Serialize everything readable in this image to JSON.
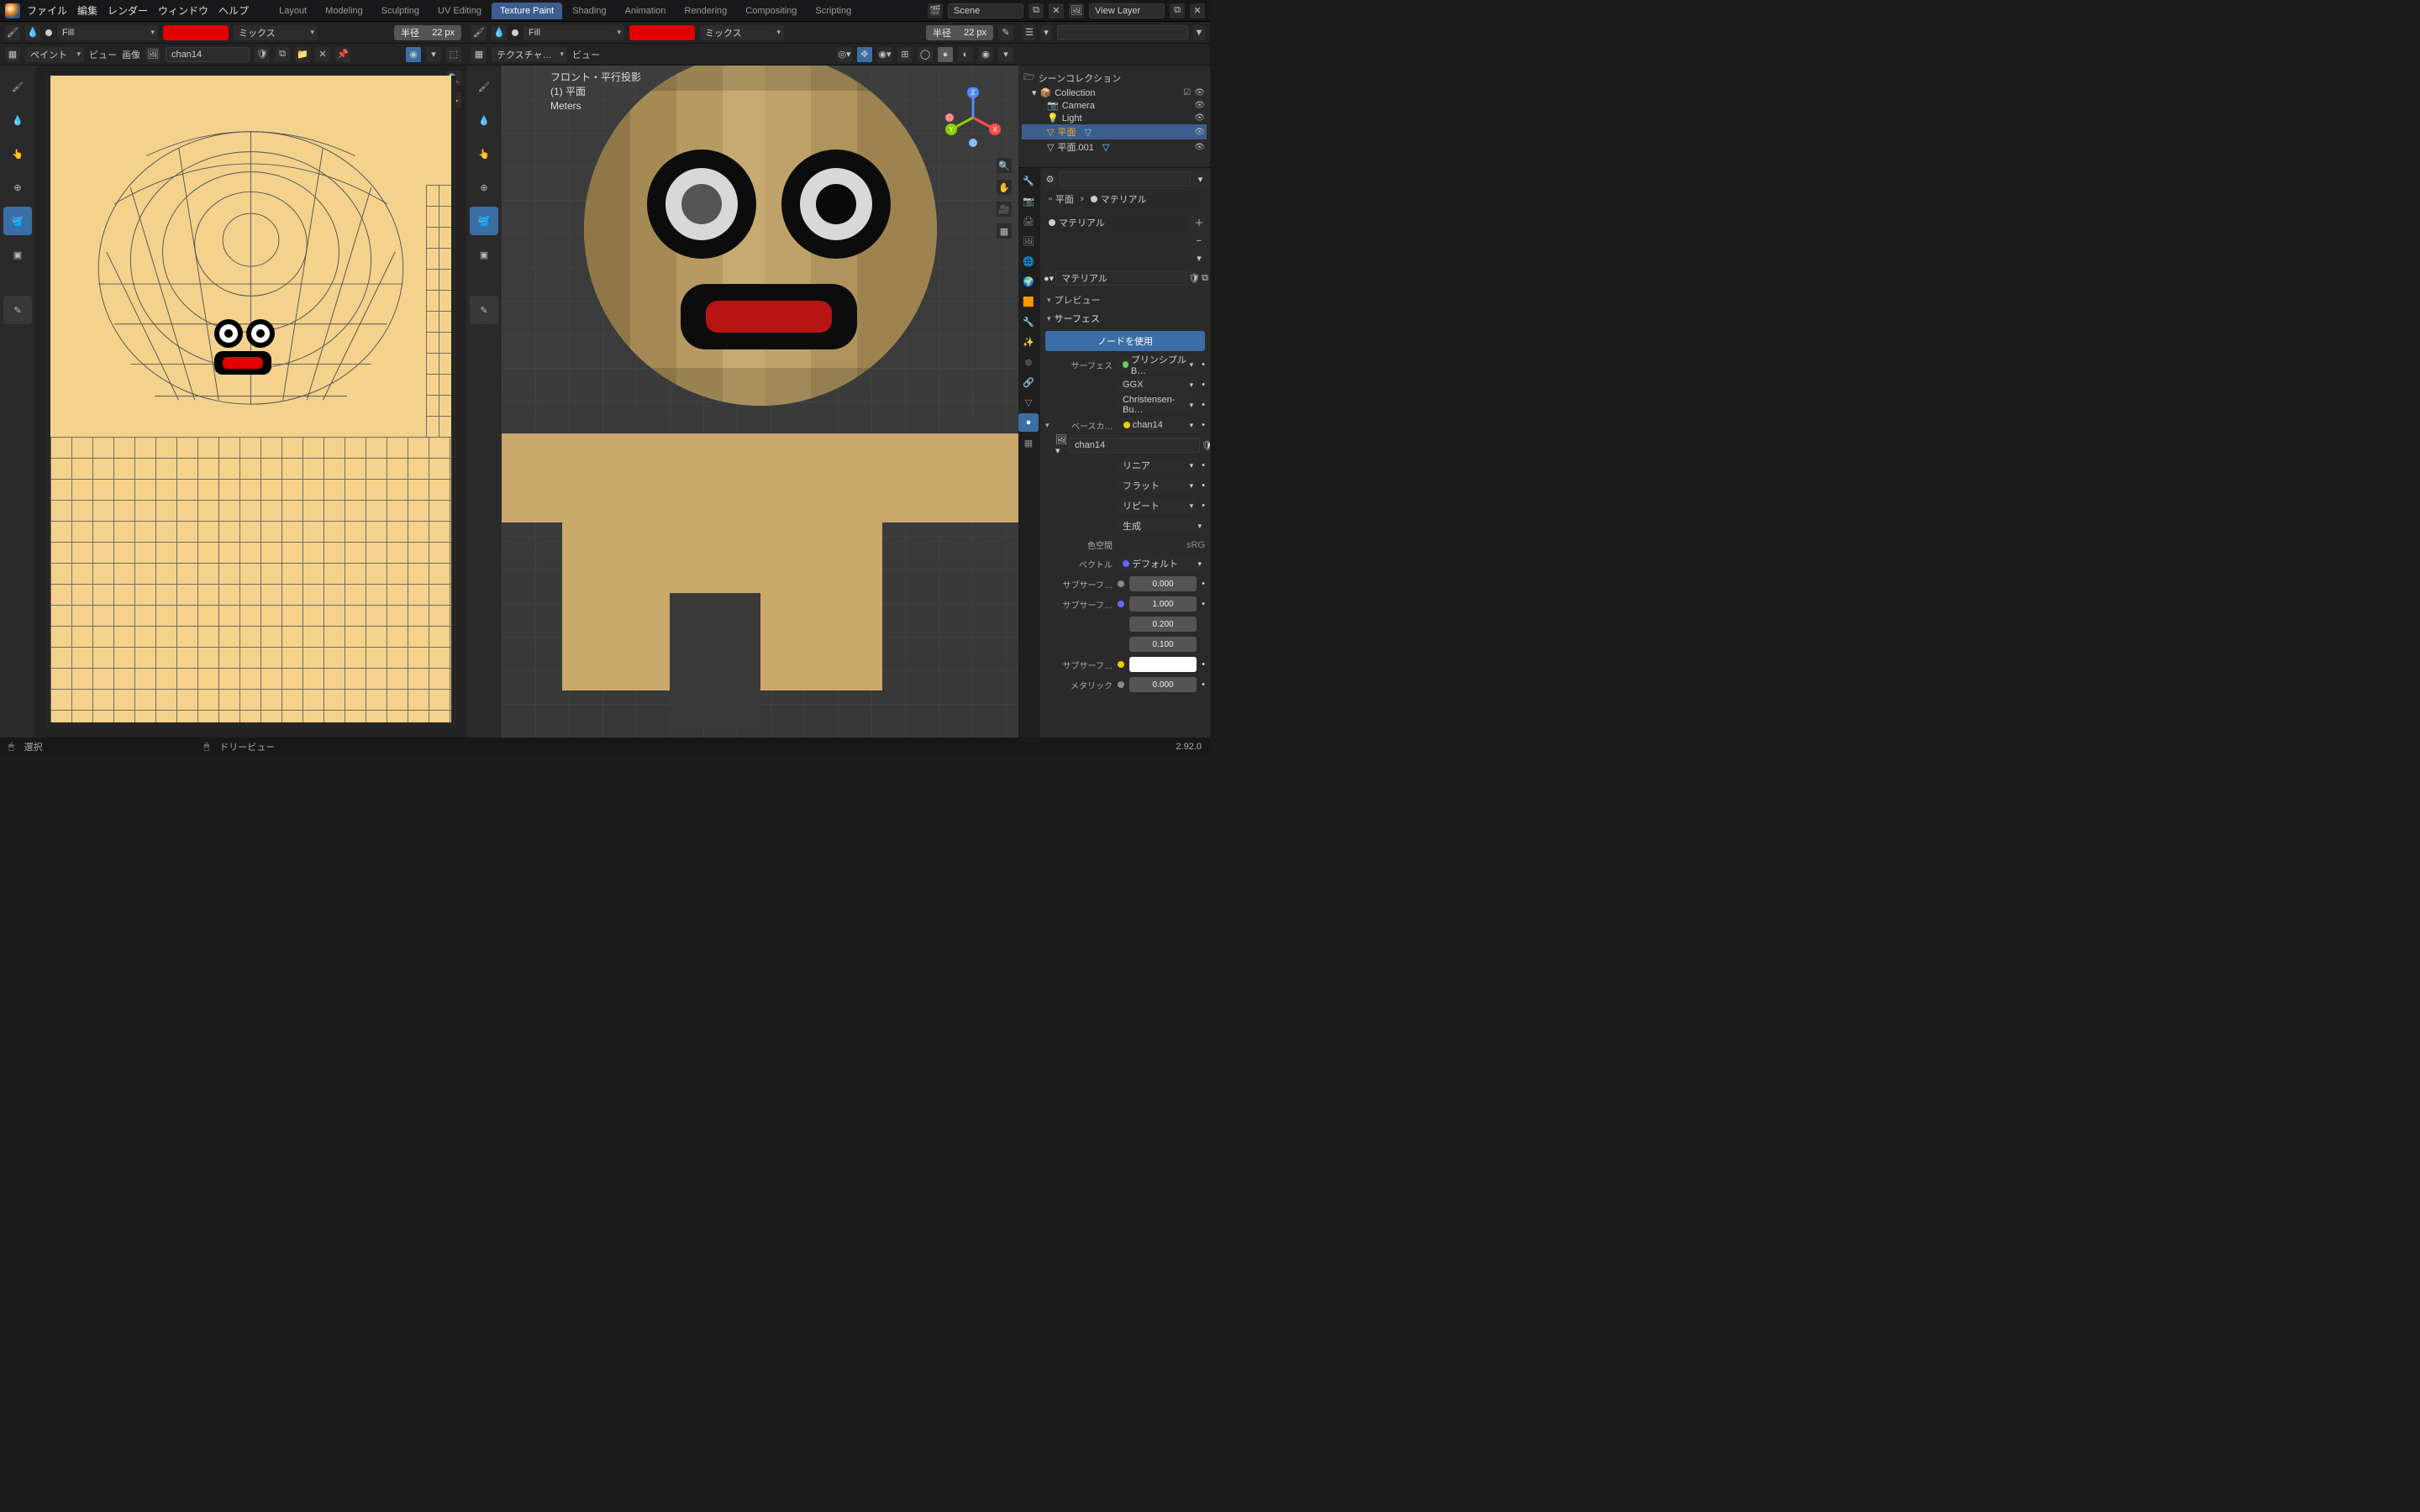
{
  "topmenu": {
    "file": "ファイル",
    "edit": "編集",
    "render": "レンダー",
    "window": "ウィンドウ",
    "help": "ヘルプ"
  },
  "tabs": [
    "Layout",
    "Modeling",
    "Sculpting",
    "UV Editing",
    "Texture Paint",
    "Shading",
    "Animation",
    "Rendering",
    "Compositing",
    "Scripting"
  ],
  "active_tab": "Texture Paint",
  "scene": {
    "label": "Scene",
    "viewlayer": "View Layer"
  },
  "tool_header": {
    "brush_mode": "Fill",
    "blend": "ミックス",
    "radius_label": "半径",
    "radius_value": "22 px"
  },
  "img_header": {
    "paint": "ペイント",
    "view": "ビュー",
    "image": "画像",
    "texture_name": "chan14"
  },
  "vp_header": {
    "texchannel": "テクスチャ…",
    "view": "ビュー"
  },
  "vp_overlay": {
    "proj": "フロント・平行投影",
    "obj": "(1) 平面",
    "units": "Meters"
  },
  "outliner": {
    "scene_collection": "シーンコレクション",
    "collection": "Collection",
    "items": [
      {
        "name": "Camera",
        "icon": "📷"
      },
      {
        "name": "Light",
        "icon": "💡"
      },
      {
        "name": "平面",
        "icon": "▽",
        "selected": true
      },
      {
        "name": "平面.001",
        "icon": "▽"
      }
    ]
  },
  "props": {
    "object": "平面",
    "material_tab": "マテリアル",
    "material_slot": "マテリアル",
    "material_name": "マテリアル",
    "preview": "プレビュー",
    "surface": "サーフェス",
    "use_nodes": "ノードを使用",
    "surface_label": "サーフェス",
    "shader": "プリンシプルB…",
    "distribution": "GGX",
    "sss": "Christensen-Bu…",
    "basecolor_label": "ベースカ…",
    "basecolor_tex": "chan14",
    "tex_name": "chan14",
    "interp": "リニア",
    "proj": "フラット",
    "ext": "リピート",
    "source": "生成",
    "colorspace_label": "色空間",
    "colorspace": "sRG",
    "vector_label": "ベクトル",
    "vector_value": "デフォルト",
    "subsurf_label": "サブサーフ…",
    "subsurf_value": "0.000",
    "subsurf_radius_label": "サブサーフ…",
    "subsurf_radius": [
      "1.000",
      "0.200",
      "0.100"
    ],
    "subsurf_col_label": "サブサーフ…",
    "metallic_label": "メタリック",
    "metallic": "0.000"
  },
  "status": {
    "select": "選択",
    "dolly": "ドリービュー",
    "version": "2.92.0"
  }
}
